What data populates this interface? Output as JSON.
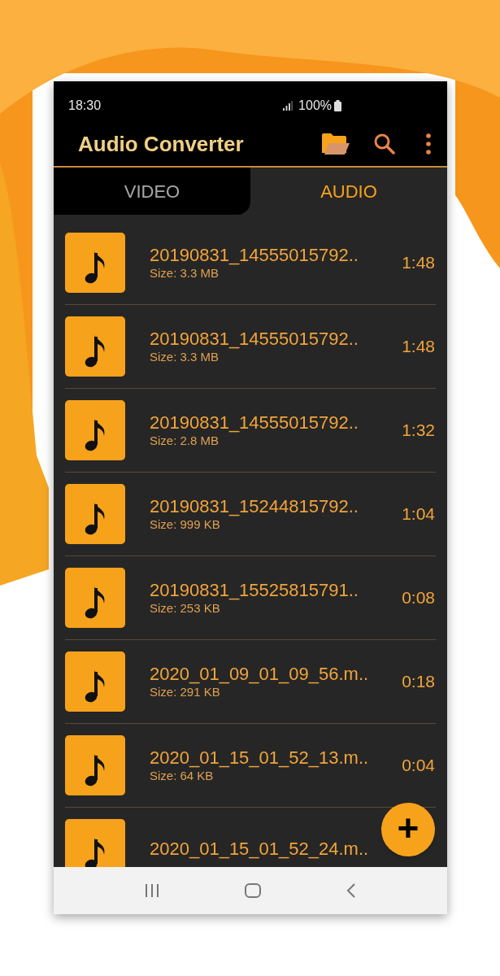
{
  "status_bar": {
    "time": "18:30",
    "battery": "100%"
  },
  "app_bar": {
    "title": "Audio Converter"
  },
  "tabs": [
    {
      "label": "VIDEO",
      "selected": false
    },
    {
      "label": "AUDIO",
      "selected": true
    }
  ],
  "files": [
    {
      "name": "20190831_14555015792..",
      "size": "Size: 3.3 MB",
      "duration": "1:48"
    },
    {
      "name": "20190831_14555015792..",
      "size": "Size: 3.3 MB",
      "duration": "1:48"
    },
    {
      "name": "20190831_14555015792..",
      "size": "Size: 2.8 MB",
      "duration": "1:32"
    },
    {
      "name": "20190831_15244815792..",
      "size": "Size: 999 KB",
      "duration": "1:04"
    },
    {
      "name": "20190831_15525815791..",
      "size": "Size: 253 KB",
      "duration": "0:08"
    },
    {
      "name": "2020_01_09_01_09_56.m..",
      "size": "Size: 291 KB",
      "duration": "0:18"
    },
    {
      "name": "2020_01_15_01_52_13.m..",
      "size": "Size: 64 KB",
      "duration": "0:04"
    },
    {
      "name": "2020_01_15_01_52_24.m.."
    }
  ],
  "fab": {
    "label": "+"
  }
}
